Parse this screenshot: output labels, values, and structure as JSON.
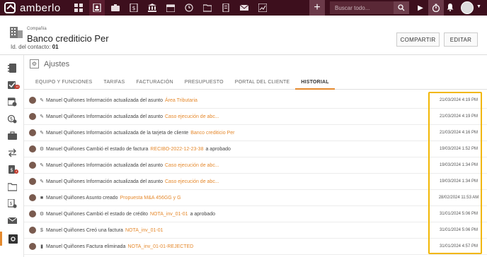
{
  "app": {
    "name": "amberlo"
  },
  "search": {
    "placeholder": "Buscar todo..."
  },
  "header": {
    "company_label": "Compañía",
    "company_name": "Banco crediticio Per",
    "contact_id_label": "Id. del contacto:",
    "contact_id_value": "01",
    "share_button": "COMPARTIR",
    "edit_button": "EDITAR"
  },
  "sidebar": {
    "badges": [
      "10",
      "4"
    ]
  },
  "panel": {
    "title": "Ajustes",
    "tabs": [
      "EQUIPO Y FUNCIONES",
      "TARIFAS",
      "FACTURACIÓN",
      "PRESUPUESTO",
      "PORTAL DEL CLIENTE",
      "HISTORIAL"
    ],
    "active_tab": "HISTORIAL"
  },
  "history": [
    {
      "icon": "pencil-icon",
      "text": "Manuel Quiñones Información actualizada del asunto",
      "link": "Área Tributaria",
      "after": "",
      "date": "21/03/2024 4:19 PM"
    },
    {
      "icon": "pencil-icon",
      "text": "Manuel Quiñones Información actualizada del asunto",
      "link": "Caso ejecución de abc...",
      "after": "",
      "date": "21/03/2024 4:19 PM"
    },
    {
      "icon": "pencil-icon",
      "text": "Manuel Quiñones Información actualizada de la tarjeta de cliente",
      "link": "Banco crediticio Per",
      "after": "",
      "date": "21/03/2024 4:16 PM"
    },
    {
      "icon": "gear-icon",
      "text": "Manuel Quiñones Cambió el estado de factura",
      "link": "RECIBO-2022-12-23-38",
      "after": "a aprobado",
      "date": "19/03/2024 1:52 PM"
    },
    {
      "icon": "pencil-icon",
      "text": "Manuel Quiñones Información actualizada del asunto",
      "link": "Caso ejecución de abc...",
      "after": "",
      "date": "19/03/2024 1:34 PM"
    },
    {
      "icon": "pencil-icon",
      "text": "Manuel Quiñones Información actualizada del asunto",
      "link": "Caso ejecución de abc...",
      "after": "",
      "date": "19/03/2024 1:34 PM"
    },
    {
      "icon": "briefcase-icon",
      "text": "Manuel Quiñones Asunto creado",
      "link": "Propuesta M&A 456GG y G",
      "after": "",
      "date": "28/02/2024 11:53 AM"
    },
    {
      "icon": "gear-icon",
      "text": "Manuel Quiñones Cambió el estado de crédito",
      "link": "NOTA_inv_01-01",
      "after": "a aprobado",
      "date": "31/01/2024 5:06 PM"
    },
    {
      "icon": "dollar-icon",
      "text": "Manuel Quiñones Creó una factura",
      "link": "NOTA_inv_01-01",
      "after": "",
      "date": "31/01/2024 5:06 PM"
    },
    {
      "icon": "trash-icon",
      "text": "Manuel Quiñones Factura eliminada",
      "link": "NOTA_inv_01-01-REJECTED",
      "after": "",
      "date": "31/01/2024 4:57 PM"
    }
  ],
  "colors": {
    "topbar": "#3d0f1d",
    "accent": "#e5892d",
    "highlight": "#f2b705"
  }
}
